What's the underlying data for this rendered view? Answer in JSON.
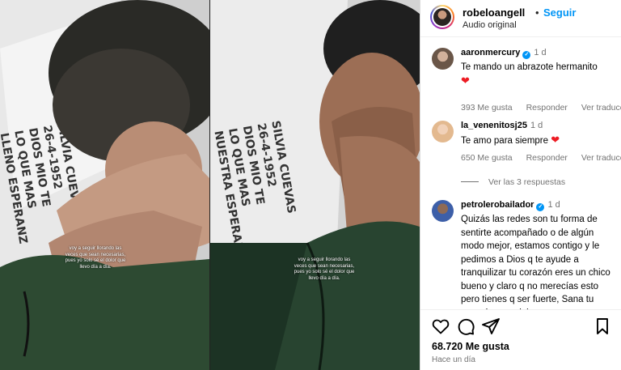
{
  "media": {
    "captions": [
      "voy a seguir llorando las veces que sean necesarias, pues yo solo sé el dolor que llevo día a día.",
      "voy a seguir llorando las veces que sean necesarias, pues yo solo sé el dolor que llevo día a día."
    ]
  },
  "header": {
    "username": "robeloangell",
    "separator": "•",
    "follow_label": "Seguir",
    "audio": "Audio original"
  },
  "comments": [
    {
      "username": "aaronmercury",
      "verified": true,
      "time": "1 d",
      "text": "Te mando un abrazote hermanito",
      "likes": "393 Me gusta",
      "reply": "Responder",
      "translate": "Ver traducción"
    },
    {
      "username": "la_venenitosj25",
      "verified": false,
      "time": "1 d",
      "text": "Te amo para siempre",
      "likes": "650 Me gusta",
      "reply": "Responder",
      "translate": "Ver traducción",
      "replies": "Ver las 3 respuestas"
    },
    {
      "username": "petrolerobailador",
      "verified": true,
      "time": "1 d",
      "text": "Quizás las redes son tu forma de sentirte acompañado o de algún modo mejor, estamos contigo y le pedimos a Dios q te ayude a tranquilizar tu corazón eres un chico bueno y claro q no merecías esto pero tienes q ser fuerte, Sana tu corazón con el tiempo que sea"
    }
  ],
  "footer": {
    "likes": "68.720 Me gusta",
    "time_ago": "Hace un día"
  },
  "colors": {
    "follow": "#0095f6",
    "heart": "#ed1c24",
    "muted": "#737373"
  }
}
